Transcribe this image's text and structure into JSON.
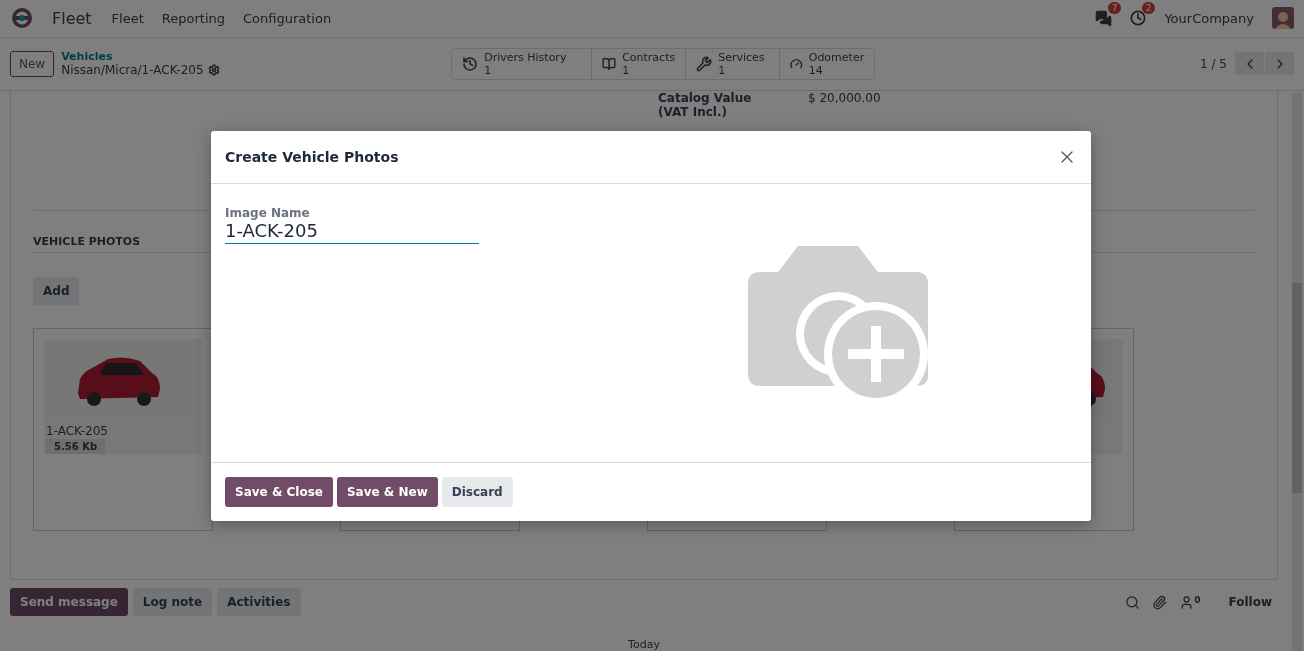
{
  "navbar": {
    "app": "Fleet",
    "menus": [
      "Fleet",
      "Reporting",
      "Configuration"
    ],
    "messages_badge": "7",
    "activities_badge": "2",
    "company": "YourCompany"
  },
  "control_panel": {
    "new_button": "New",
    "breadcrumb": "Vehicles",
    "record": "Nissan/Micra/1-ACK-205",
    "stats": [
      {
        "kind": "history",
        "label": "Drivers History",
        "value": "1"
      },
      {
        "kind": "contracts",
        "label": "Contracts",
        "value": "1"
      },
      {
        "kind": "services",
        "label": "Services",
        "value": "1"
      },
      {
        "kind": "odometer",
        "label": "Odometer",
        "value": "14"
      }
    ],
    "pager": "1 / 5"
  },
  "form": {
    "catalog_label": "Catalog Value (VAT Incl.)",
    "catalog_value": "$ 20,000.00",
    "section_title": "VEHICLE PHOTOS",
    "add_button": "Add",
    "photos": [
      {
        "kind": "shown",
        "name": "1-ACK-205",
        "size": "5.56 Kb"
      },
      {
        "kind": "covered"
      },
      {
        "kind": "covered"
      },
      {
        "kind": "edge"
      }
    ]
  },
  "chatter": {
    "buttons": [
      {
        "label": "Send message",
        "selected": true
      },
      {
        "label": "Log note",
        "selected": false
      },
      {
        "label": "Activities",
        "selected": false
      }
    ],
    "followers": "0",
    "follow": "Follow",
    "date_separator": "Today"
  },
  "dialog": {
    "title": "Create Vehicle Photos",
    "field_label": "Image Name",
    "field_value": "1-ACK-205",
    "buttons": [
      {
        "label": "Save & Close",
        "kind": "primary"
      },
      {
        "label": "Save & New",
        "kind": "primary"
      },
      {
        "label": "Discard",
        "kind": "secondary"
      }
    ]
  }
}
